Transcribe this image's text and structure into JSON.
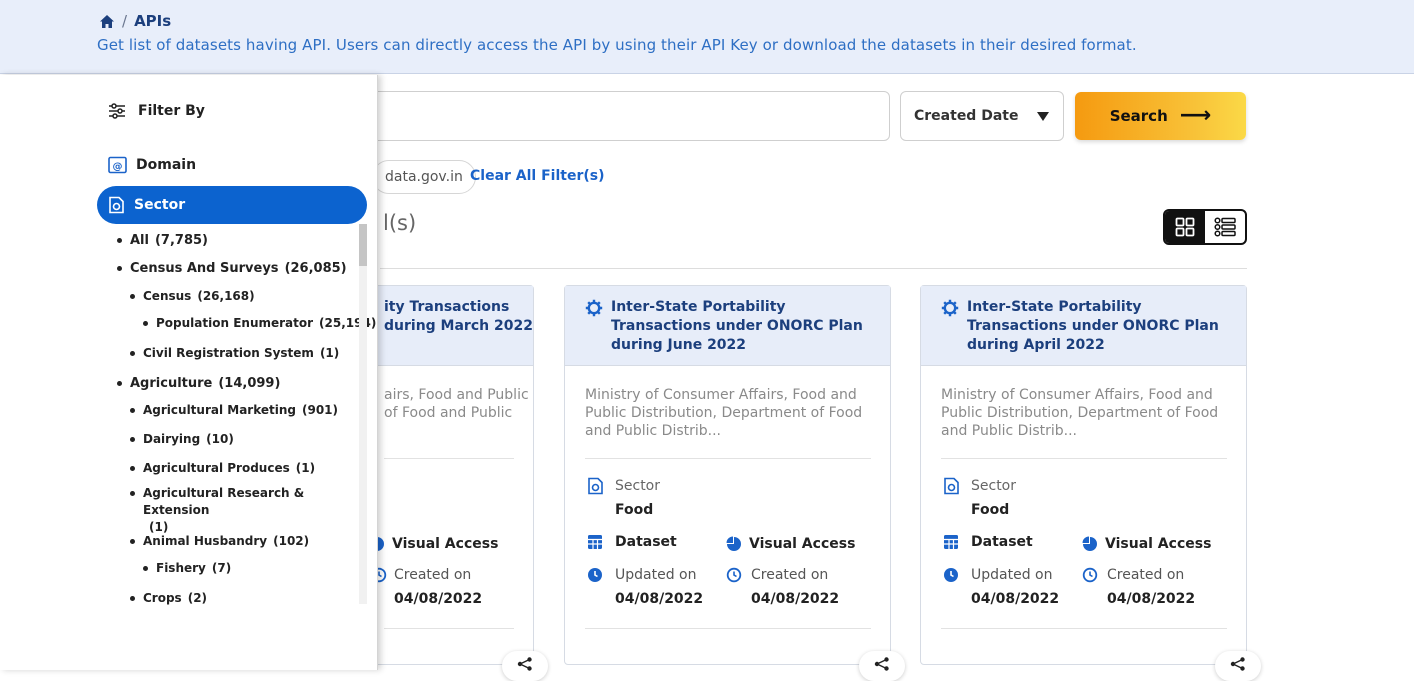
{
  "header": {
    "breadcrumb_current": "APIs",
    "breadcrumb_sep": "/",
    "subtitle": "Get list of datasets having API. Users can directly access the API by using their API Key or download the datasets in their desired format."
  },
  "toolbar": {
    "search_placeholder": "",
    "sort_selected": "Created Date",
    "search_label": "Search",
    "search_arrow": "⟶"
  },
  "filters": {
    "chip_label": "data.gov.in",
    "clear_label": "Clear All Filter(s)"
  },
  "results": {
    "count_text": "l(s)"
  },
  "sidebar": {
    "filter_by": "Filter By",
    "domain": "Domain",
    "sector": "Sector",
    "items": [
      {
        "label": "All",
        "count": "(7,785)"
      },
      {
        "label": "Census And Surveys",
        "count": "(26,085)"
      },
      {
        "label": "Census",
        "count": "(26,168)"
      },
      {
        "label": "Population Enumerator",
        "count": "(25,194)"
      },
      {
        "label": "Civil Registration System",
        "count": "(1)"
      },
      {
        "label": "Agriculture",
        "count": "(14,099)"
      },
      {
        "label": "Agricultural Marketing",
        "count": "(901)"
      },
      {
        "label": "Dairying",
        "count": "(10)"
      },
      {
        "label": "Agricultural Produces",
        "count": "(1)"
      },
      {
        "label": "Agricultural Research & Extension",
        "count": "(1)"
      },
      {
        "label": "Animal Husbandry",
        "count": "(102)"
      },
      {
        "label": "Fishery",
        "count": "(7)"
      },
      {
        "label": "Crops",
        "count": "(2)"
      }
    ]
  },
  "cards": [
    {
      "title_line1": "ity Transactions",
      "title_line2": "during March 2022",
      "org_line1": "airs, Food and Public",
      "org_line2": "of Food and Public",
      "visual_access": "Visual Access",
      "created_on": "Created on",
      "created_value": "04/08/2022"
    },
    {
      "title": "Inter-State Portability Transactions under ONORC Plan during June 2022",
      "org": "Ministry of Consumer Affairs, Food and Public Distribution, Department of Food and Public Distrib...",
      "sector_label": "Sector",
      "sector_value": "Food",
      "dataset_label": "Dataset",
      "visual_access": "Visual Access",
      "updated_on": "Updated on",
      "updated_value": "04/08/2022",
      "created_on": "Created on",
      "created_value": "04/08/2022"
    },
    {
      "title": "Inter-State Portability Transactions under ONORC Plan during April 2022",
      "org": "Ministry of Consumer Affairs, Food and Public Distribution, Department of Food and Public Distrib...",
      "sector_label": "Sector",
      "sector_value": "Food",
      "dataset_label": "Dataset",
      "visual_access": "Visual Access",
      "updated_on": "Updated on",
      "updated_value": "04/08/2022",
      "created_on": "Created on",
      "created_value": "04/08/2022"
    }
  ],
  "colors": {
    "brand_blue": "#0c63cf",
    "title_navy": "#1c3f7d",
    "header_band": "#e8eefa",
    "search_gradient_start": "#f59a10",
    "search_gradient_end": "#fbd947"
  }
}
